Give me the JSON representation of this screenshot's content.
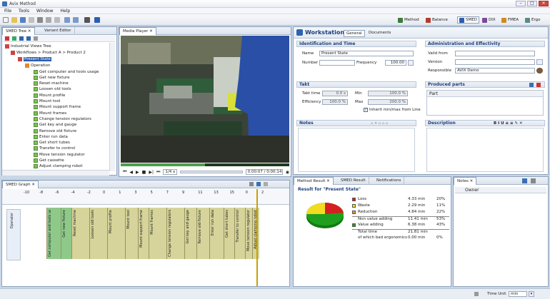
{
  "window": {
    "title": "Avix Method"
  },
  "menu": [
    "File",
    "Tools",
    "Window",
    "Help"
  ],
  "perspectives": [
    {
      "label": "Method",
      "color": "#3c7a3c"
    },
    {
      "label": "Balance",
      "color": "#b33b2b"
    },
    {
      "label": "SMED",
      "color": "#2b5fb0"
    },
    {
      "label": "DIX",
      "color": "#7a4a9a"
    },
    {
      "label": "FMEA",
      "color": "#d08a20"
    },
    {
      "label": "Ergo",
      "color": "#5a8a8a"
    }
  ],
  "left_panel": {
    "tabs": [
      "SMED Tree",
      "Variant Editor"
    ],
    "tree_root": "Industrial Views Tree",
    "tree_sub": "Workflows > Product A > Product 2",
    "tree_state": "Present State",
    "tree_group": "Operation",
    "tasks": [
      "Get computer and tools usage",
      "Get new fixture",
      "Reset machine",
      "Loosen old tools",
      "Mount profile",
      "Mount tool",
      "Mount support frame",
      "Mount frames",
      "Change tension regulators",
      "Get key and gauge",
      "Remove old fixture",
      "Enter run data",
      "Get short tubes",
      "Transfer to control",
      "Move tension regulator",
      "Get cassette",
      "Adjust clamping robot"
    ]
  },
  "media_player": {
    "tab": "Media Player",
    "speed": "1/4 x",
    "time": "0.00:07 / 0:00:14"
  },
  "workstation": {
    "title": "Workstation",
    "tabs": [
      "General",
      "Documents"
    ],
    "id_section": "Identification and Time",
    "name_label": "Name",
    "name_value": "Present State",
    "number_label": "Number",
    "frequency_label": "Frequency",
    "frequency_value": "100.00",
    "admin_section": "Administration and Effectivity",
    "valid_from_label": "Valid from",
    "version_label": "Version",
    "responsible_label": "Responsible",
    "responsible_value": "AVIX Demo",
    "takt_section": "Takt",
    "takt_label": "Takt time",
    "takt_value": "0.0 s",
    "efficiency_label": "Efficiency",
    "efficiency_value": "100.0 %",
    "min_label": "Min",
    "min_value": "100.0 %",
    "max_label": "Max",
    "max_value": "200.0 %",
    "inherit_label": "Inherit min/max from Line",
    "produced_section": "Produced parts",
    "part_header": "Part",
    "notes_section": "Notes",
    "description_section": "Description"
  },
  "smed_graph": {
    "tab": "SMED Graph",
    "axis_labels": [
      "-10",
      "-8",
      "-6",
      "-4",
      "-2",
      "0",
      "1",
      "3",
      "5",
      "7",
      "9",
      "11",
      "13",
      "15",
      "0",
      "2"
    ],
    "operator_label": "Operator",
    "activities": [
      "Get computer and tools usage",
      "Get new fixture",
      "Reset machine",
      "Loosen old tools",
      "Mount profile",
      "Mount tool",
      "Mount support frame",
      "Mount frames",
      "Change tension regulators",
      "Get key and gauge",
      "Remove old fixture",
      "Enter run data",
      "Get short tubes",
      "Transfer to control",
      "Move tension regulator",
      "Adjust clamping robot"
    ]
  },
  "results": {
    "tabs": [
      "Method Result",
      "SMED Result",
      "Notifications"
    ],
    "title": "Result for \"Present State\"",
    "rows": [
      {
        "label": "Loss",
        "value": "4.33 min",
        "pct": "20%",
        "color": "#d42020"
      },
      {
        "label": "Waste",
        "value": "2.29 min",
        "pct": "11%",
        "color": "#f2dc20"
      },
      {
        "label": "Reduction",
        "value": "4.84 min",
        "pct": "22%",
        "color": "#e89a20"
      },
      {
        "label": "Non value adding",
        "value": "11.41 min",
        "pct": "53%",
        "color": ""
      },
      {
        "label": "Value adding",
        "value": "6.38 min",
        "pct": "43%",
        "color": "#1ea01e"
      },
      {
        "label": "Total time",
        "value": "21.81 min",
        "pct": "",
        "color": ""
      },
      {
        "label": "of which bad ergonomics",
        "value": "0.00 min",
        "pct": "0%",
        "color": ""
      }
    ]
  },
  "notes_panel": {
    "tab": "Notes",
    "header": "Owner"
  },
  "status": {
    "time_unit_label": "Time Unit",
    "time_unit_value": "min"
  }
}
